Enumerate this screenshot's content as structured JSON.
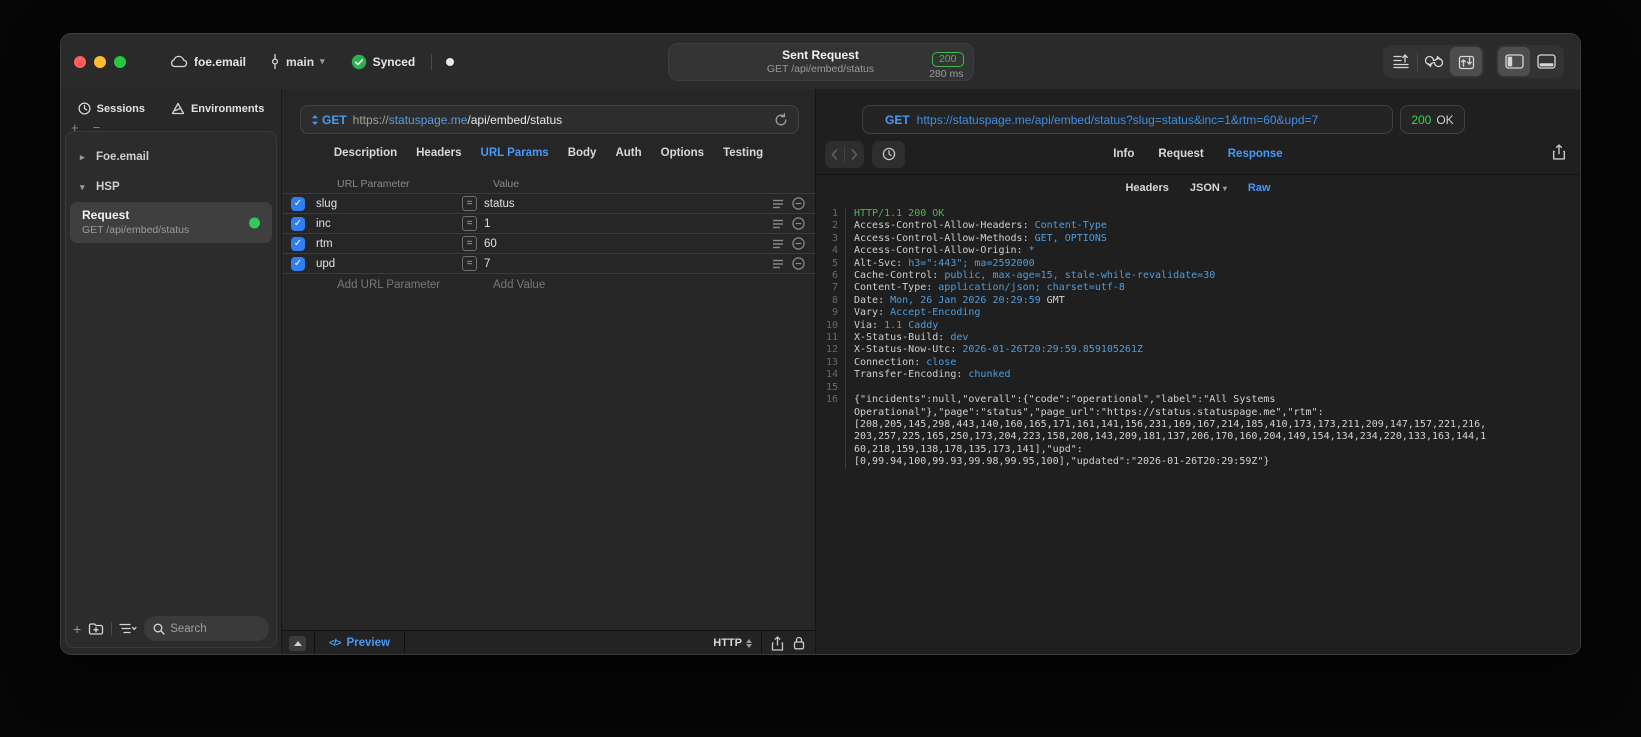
{
  "colors": {
    "accent": "#4799f7",
    "success": "#32d74b",
    "badge_green": "#3fb950"
  },
  "titlebar": {
    "project": "foe.email",
    "branch": "main",
    "sync_status": "Synced",
    "title": "Sent Request",
    "subtitle": "GET /api/embed/status",
    "status_code": "200",
    "duration": "280 ms"
  },
  "sidebar": {
    "tabs": [
      {
        "label": "Sessions"
      },
      {
        "label": "Environments"
      }
    ],
    "tree": [
      {
        "label": "Foe.email"
      },
      {
        "label": "HSP"
      }
    ],
    "request_item": {
      "title": "Request",
      "subtitle": "GET /api/embed/status"
    },
    "search_placeholder": "Search"
  },
  "request_panel": {
    "method": "GET",
    "url_scheme": "https://",
    "url_host": "statuspage.me",
    "url_path": "/api/embed/status",
    "tabs": [
      "Description",
      "Headers",
      "URL Params",
      "Body",
      "Auth",
      "Options",
      "Testing"
    ],
    "active_tab": "URL Params",
    "param_table": {
      "columns": [
        "URL Parameter",
        "Value"
      ],
      "rows": [
        {
          "name": "slug",
          "value": "status",
          "checked": true
        },
        {
          "name": "inc",
          "value": "1",
          "checked": true
        },
        {
          "name": "rtm",
          "value": "60",
          "checked": true
        },
        {
          "name": "upd",
          "value": "7",
          "checked": true
        }
      ],
      "add_param_label": "Add URL Parameter",
      "add_value_label": "Add Value"
    },
    "footer": {
      "preview_label": "Preview",
      "protocol": "HTTP"
    }
  },
  "response_panel": {
    "method": "GET",
    "url": "https://statuspage.me/api/embed/status?slug=status&inc=1&rtm=60&upd=7",
    "status_code": "200",
    "status_text": "OK",
    "tabs": [
      "Info",
      "Request",
      "Response"
    ],
    "active_tab": "Response",
    "subtabs": [
      {
        "label": "Headers"
      },
      {
        "label": "JSON",
        "dropdown": true
      },
      {
        "label": "Raw"
      }
    ],
    "active_subtab": "Raw",
    "code_lines": [
      {
        "n": "1",
        "parts": [
          [
            "s",
            "HTTP/1.1 200 OK"
          ]
        ]
      },
      {
        "n": "2",
        "parts": [
          [
            "k",
            "Access-Control-Allow-Headers: "
          ],
          [
            "v",
            "Content-Type"
          ]
        ]
      },
      {
        "n": "3",
        "parts": [
          [
            "k",
            "Access-Control-Allow-Methods: "
          ],
          [
            "v",
            "GET, OPTIONS"
          ]
        ]
      },
      {
        "n": "4",
        "parts": [
          [
            "k",
            "Access-Control-Allow-Origin: "
          ],
          [
            "v",
            "*"
          ]
        ]
      },
      {
        "n": "5",
        "parts": [
          [
            "k",
            "Alt-Svc: "
          ],
          [
            "v",
            "h3=\":443\"; ma=2592000"
          ]
        ]
      },
      {
        "n": "6",
        "parts": [
          [
            "k",
            "Cache-Control: "
          ],
          [
            "v",
            "public, max-age=15, stale-while-revalidate=30"
          ]
        ]
      },
      {
        "n": "7",
        "parts": [
          [
            "k",
            "Content-Type: "
          ],
          [
            "v",
            "application/json; charset=utf-8"
          ]
        ]
      },
      {
        "n": "8",
        "parts": [
          [
            "k",
            "Date: "
          ],
          [
            "v",
            "Mon, 26 Jan 2026 20:29:59"
          ],
          [
            "k",
            " GMT"
          ]
        ]
      },
      {
        "n": "9",
        "parts": [
          [
            "k",
            "Vary: "
          ],
          [
            "v",
            "Accept-Encoding"
          ]
        ]
      },
      {
        "n": "10",
        "parts": [
          [
            "k",
            "Via: "
          ],
          [
            "v",
            "1.1 Caddy"
          ]
        ]
      },
      {
        "n": "11",
        "parts": [
          [
            "k",
            "X-Status-Build: "
          ],
          [
            "v",
            "dev"
          ]
        ]
      },
      {
        "n": "12",
        "parts": [
          [
            "k",
            "X-Status-Now-Utc: "
          ],
          [
            "v",
            "2026-01-26T20:29:59.859105261Z"
          ]
        ]
      },
      {
        "n": "13",
        "parts": [
          [
            "k",
            "Connection: "
          ],
          [
            "v",
            "close"
          ]
        ]
      },
      {
        "n": "14",
        "parts": [
          [
            "k",
            "Transfer-Encoding: "
          ],
          [
            "v",
            "chunked"
          ]
        ]
      },
      {
        "n": "15",
        "parts": []
      },
      {
        "n": "16",
        "parts": [
          [
            "p",
            "{\"incidents\":null,\"overall\":{\"code\":\"operational\",\"label\":\"All Systems"
          ]
        ]
      },
      {
        "n": "",
        "parts": [
          [
            "p",
            "Operational\"},\"page\":\"status\",\"page_url\":\"https://status.statuspage.me\",\"rtm\":"
          ]
        ]
      },
      {
        "n": "",
        "parts": [
          [
            "p",
            "[208,205,145,298,443,140,160,165,171,161,141,156,231,169,167,214,185,410,173,173,211,209,147,157,221,216,"
          ]
        ]
      },
      {
        "n": "",
        "parts": [
          [
            "p",
            "203,257,225,165,250,173,204,223,158,208,143,209,181,137,206,170,160,204,149,154,134,234,220,133,163,144,1"
          ]
        ]
      },
      {
        "n": "",
        "parts": [
          [
            "p",
            "60,218,159,138,178,135,173,141],\"upd\":"
          ]
        ]
      },
      {
        "n": "",
        "parts": [
          [
            "p",
            "[0,99.94,100,99.93,99.98,99.95,100],\"updated\":\"2026-01-26T20:29:59Z\"}"
          ]
        ]
      }
    ]
  }
}
